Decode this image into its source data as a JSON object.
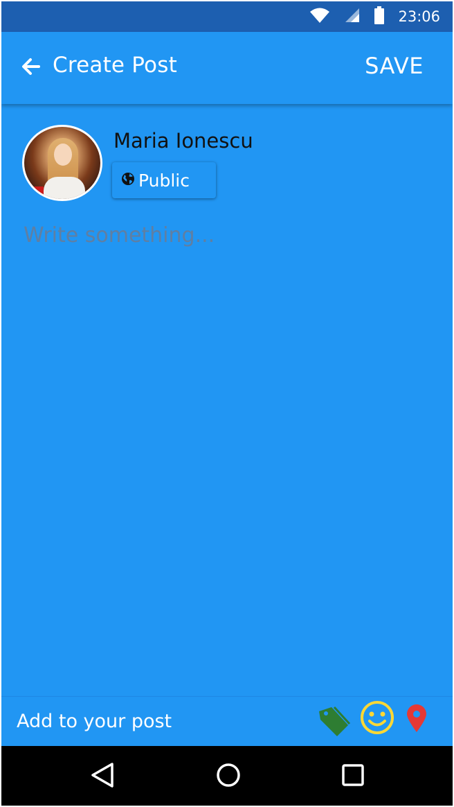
{
  "status_bar": {
    "time": "23:06",
    "icons": [
      "wifi-icon",
      "signal-icon",
      "battery-icon"
    ]
  },
  "toolbar": {
    "back_icon": "arrow-left-icon",
    "title": "Create Post",
    "save_label": "SAVE"
  },
  "user": {
    "name": "Maria Ionescu",
    "privacy": {
      "icon": "globe-icon",
      "label": "Public"
    }
  },
  "composer": {
    "placeholder": "Write something..."
  },
  "add_to_post": {
    "label": "Add to your post",
    "actions": [
      {
        "icon": "tag-icon",
        "color": "#2e7d32"
      },
      {
        "icon": "smiley-icon",
        "color": "#fdd835"
      },
      {
        "icon": "location-pin-icon",
        "color": "#e53935"
      }
    ]
  },
  "nav_bar": {
    "buttons": [
      "back-triangle-icon",
      "home-circle-icon",
      "recents-square-icon"
    ]
  },
  "colors": {
    "primary": "#2196f3",
    "status_bar": "#1d5fb0",
    "nav_bar": "#000000"
  }
}
